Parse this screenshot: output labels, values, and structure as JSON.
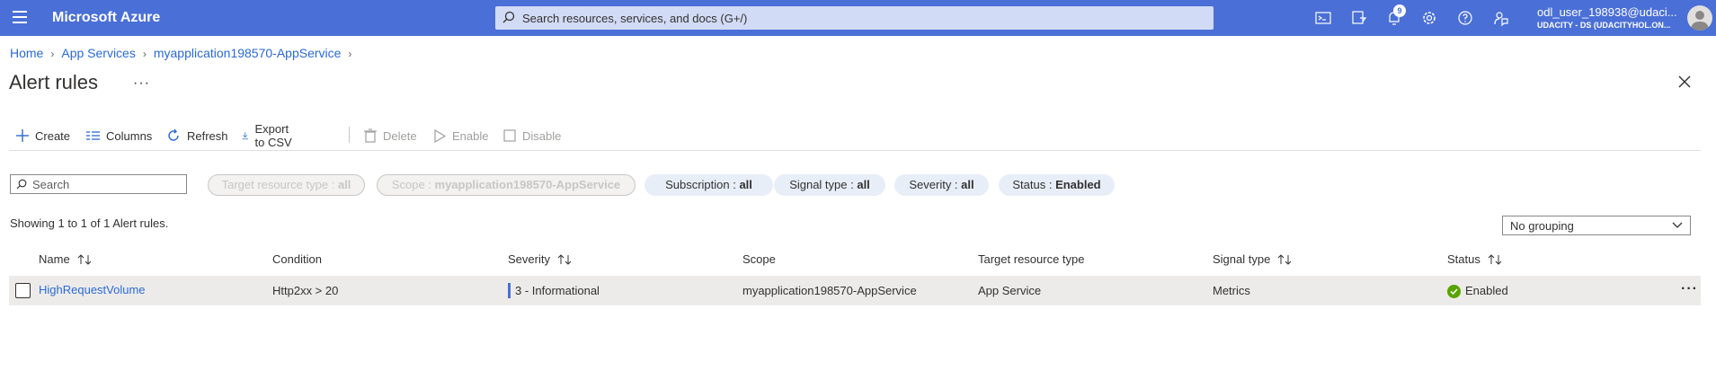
{
  "header": {
    "brand": "Microsoft Azure",
    "search_placeholder": "Search resources, services, and docs (G+/)",
    "notification_count": "9",
    "user_name": "odl_user_198938@udaci...",
    "user_tenant": "UDACITY - DS (UDACITYHOL.ON...",
    "icons": [
      "cloud-shell-icon",
      "directory-filter-icon",
      "notifications-icon",
      "settings-icon",
      "help-icon",
      "feedback-icon"
    ]
  },
  "breadcrumb": [
    "Home",
    "App Services",
    "myapplication198570-AppService"
  ],
  "page": {
    "title": "Alert rules"
  },
  "toolbar": {
    "create": "Create",
    "columns": "Columns",
    "refresh": "Refresh",
    "export": "Export to CSV",
    "delete": "Delete",
    "enable": "Enable",
    "disable": "Disable"
  },
  "filters": {
    "search_placeholder": "Search",
    "target_label": "Target resource type : ",
    "target_value": "all",
    "scope_label": "Scope : ",
    "scope_value": "myapplication198570-AppService",
    "subscription_label": "Subscription : ",
    "subscription_value": "all",
    "signal_label": "Signal type : ",
    "signal_value": "all",
    "severity_label": "Severity : ",
    "severity_value": "all",
    "status_label": "Status : ",
    "status_value": "Enabled"
  },
  "summary": "Showing 1 to 1 of 1 Alert rules.",
  "grouping": {
    "selected": "No grouping"
  },
  "table": {
    "columns": [
      "Name",
      "Condition",
      "Severity",
      "Scope",
      "Target resource type",
      "Signal type",
      "Status"
    ],
    "rows": [
      {
        "name": "HighRequestVolume",
        "condition": "Http2xx > 20",
        "severity": "3 - Informational",
        "scope": "myapplication198570-AppService",
        "target": "App Service",
        "signal": "Metrics",
        "status": "Enabled"
      }
    ]
  },
  "colors": {
    "topbar": "#4a6fd6",
    "link": "#2a6ad6",
    "status_ok": "#57a300"
  }
}
